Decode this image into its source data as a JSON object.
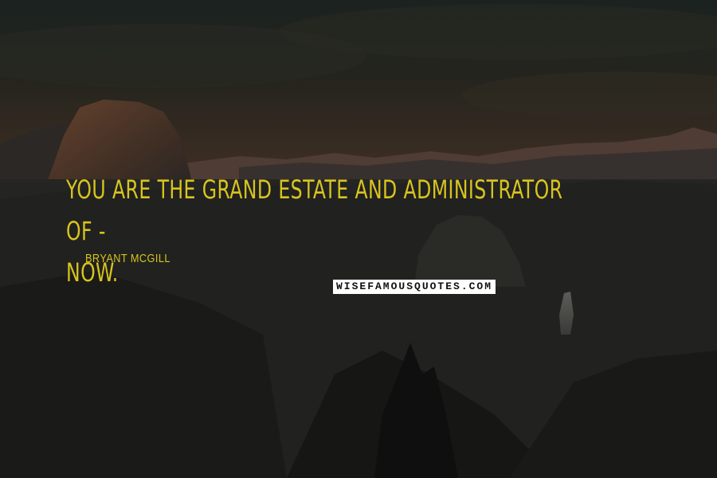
{
  "quote": {
    "line1": "YOU ARE THE GRAND ESTATE AND ADMINISTRATOR OF  -",
    "line2": "NOW.",
    "author": "BRYANT MCGILL"
  },
  "watermark": {
    "text": "WISEFAMOUSQUOTES.COM"
  },
  "colors": {
    "quote_text": "#d8c41f",
    "sky_top": "#2a3029",
    "sky_mid": "#3a3628",
    "horizon_glow": "#6a4a36",
    "mountain_dark": "#262624",
    "dome_highlight": "#8a5a3e"
  }
}
